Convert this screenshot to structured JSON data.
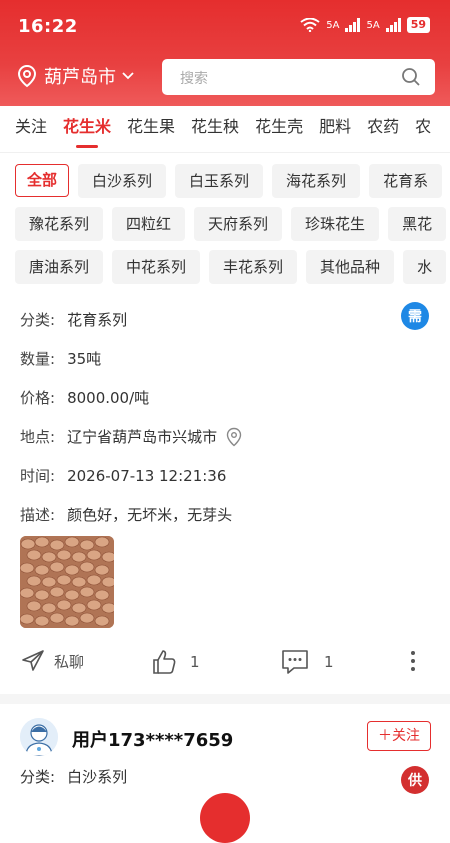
{
  "status_bar": {
    "time": "16:22",
    "net1": "5A",
    "net2": "5A",
    "battery": "59"
  },
  "header": {
    "location": "葫芦岛市",
    "search_placeholder": "搜索"
  },
  "tabs": [
    "关注",
    "花生米",
    "花生果",
    "花生秧",
    "花生壳",
    "肥料",
    "农药",
    "农"
  ],
  "active_tab": 1,
  "filters": [
    [
      "全部",
      "白沙系列",
      "白玉系列",
      "海花系列",
      "花育系"
    ],
    [
      "豫花系列",
      "四粒红",
      "天府系列",
      "珍珠花生",
      "黑花"
    ],
    [
      "唐油系列",
      "中花系列",
      "丰花系列",
      "其他品种",
      "水"
    ]
  ],
  "post1": {
    "badge": "需",
    "badge_color": "#1e88e5",
    "category_label": "分类:",
    "category": "花育系列",
    "quantity_label": "数量:",
    "quantity": "35吨",
    "price_label": "价格:",
    "price": "8000.00/吨",
    "location_label": "地点:",
    "location": "辽宁省葫芦岛市兴城市",
    "time_label": "时间:",
    "time": "2026-07-13 12:21:36",
    "desc_label": "描述:",
    "desc": "颜色好，无坏米，无芽头",
    "chat_label": "私聊",
    "likes": "1",
    "comments": "1"
  },
  "post2": {
    "user": "用户173****7659",
    "follow_label": "关注",
    "badge": "供",
    "badge_color": "#d32f2f",
    "category_label": "分类:",
    "category": "白沙系列"
  },
  "colors": {
    "brand": "#e52e2e"
  }
}
